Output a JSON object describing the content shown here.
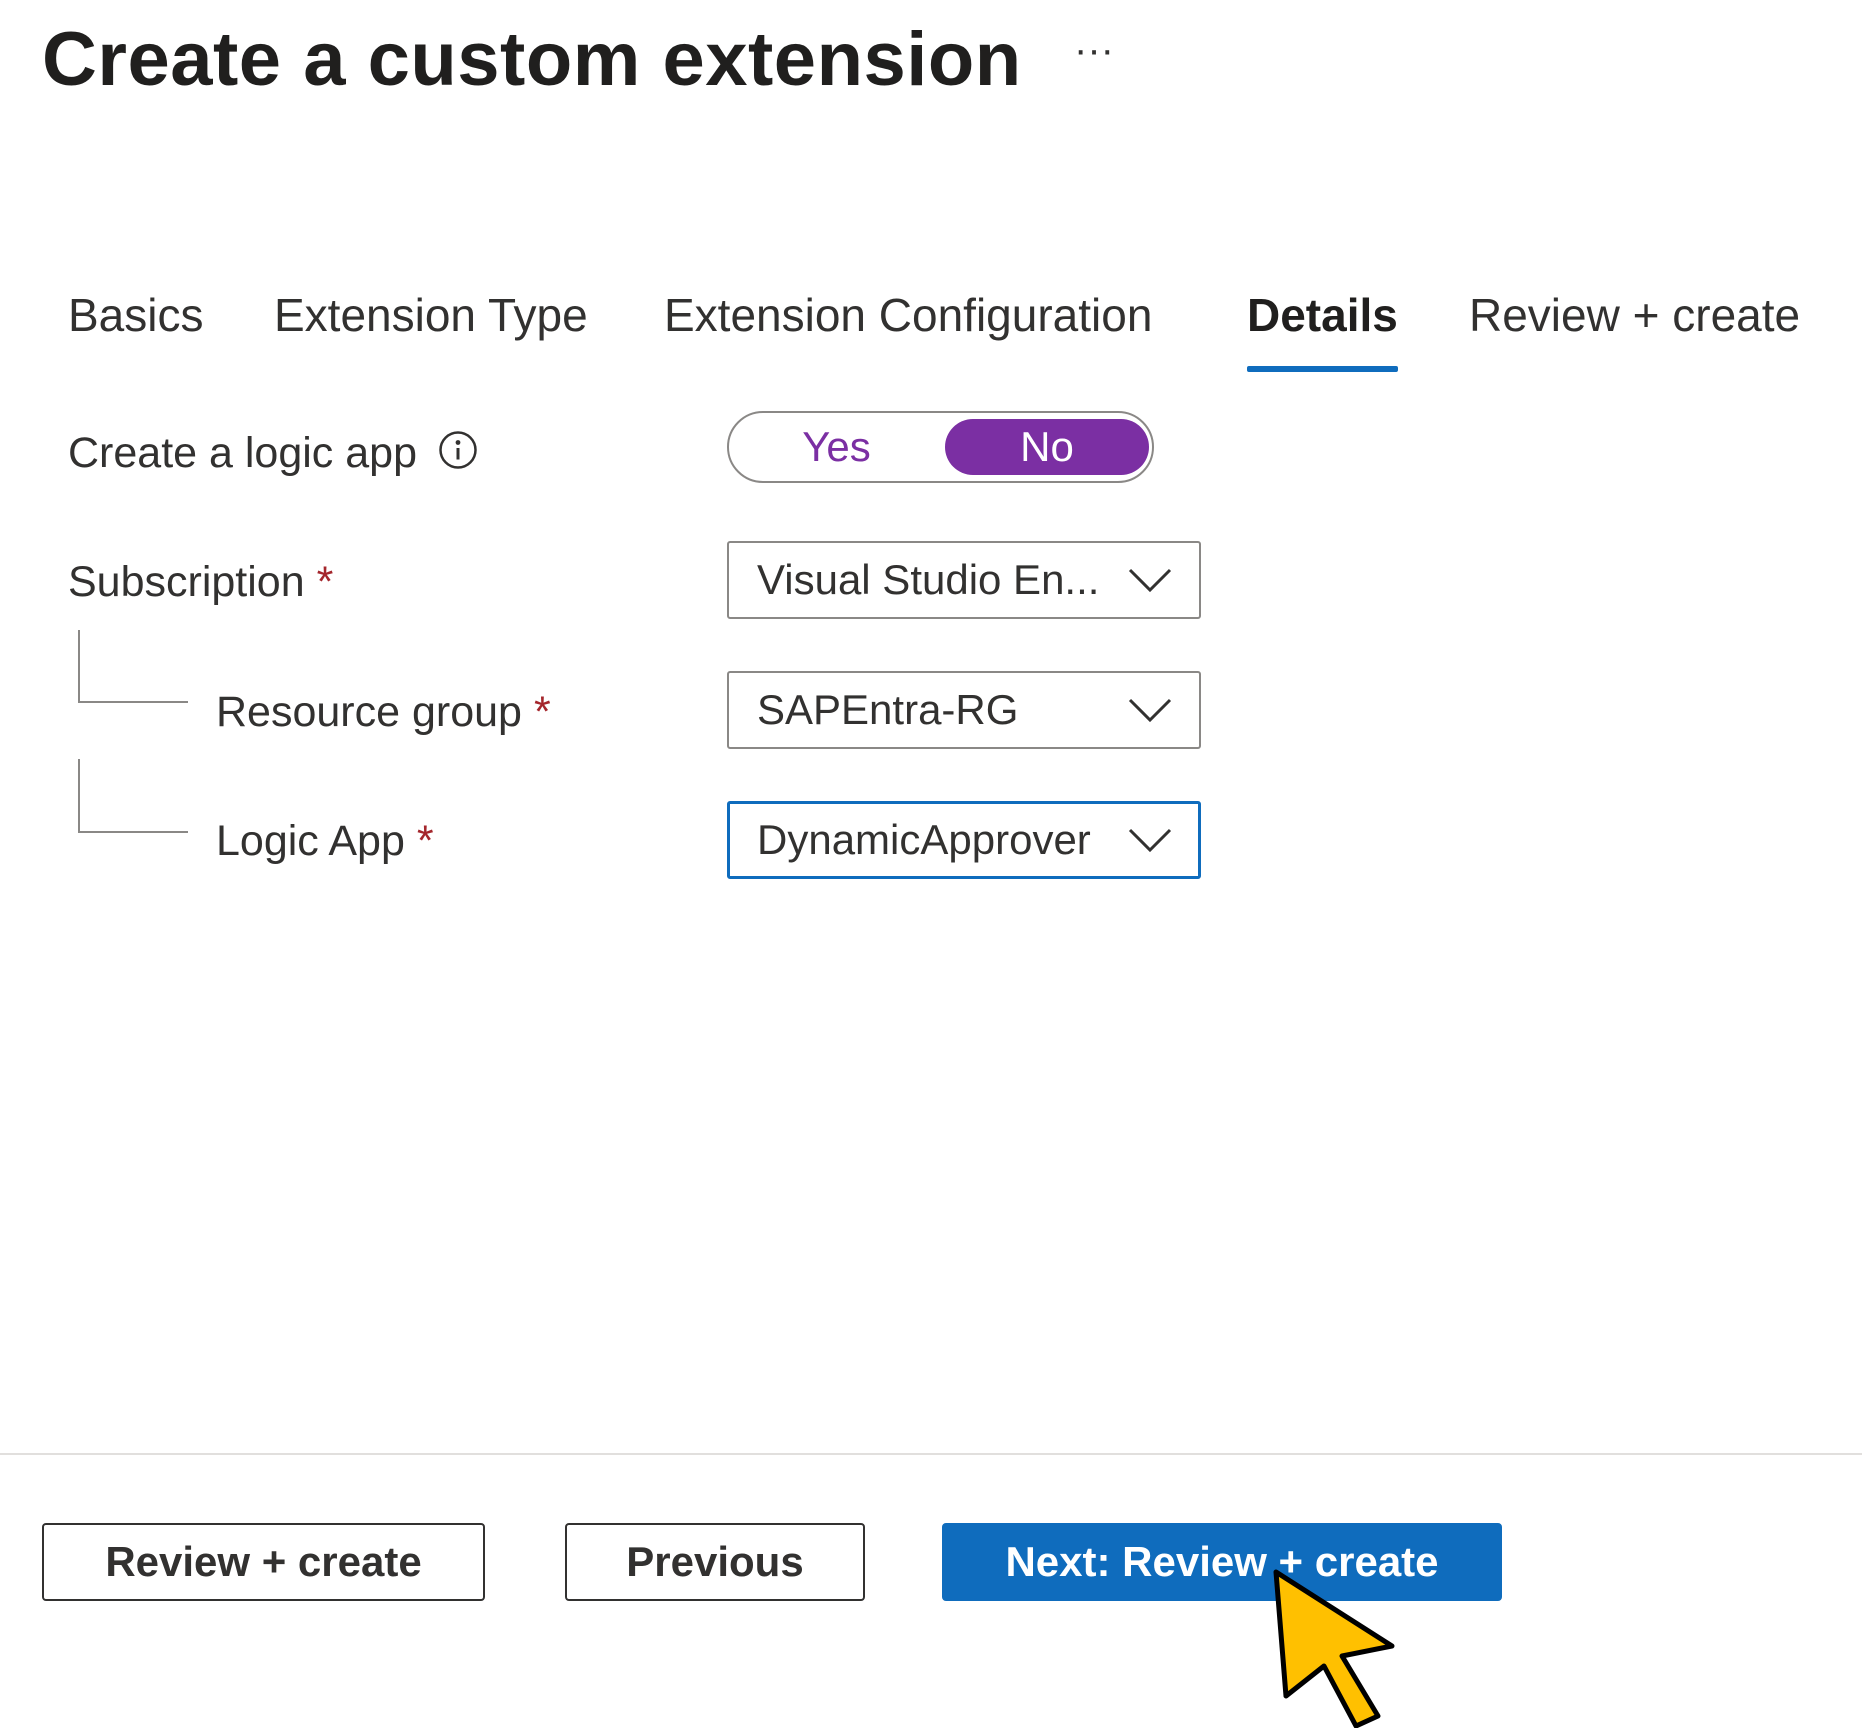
{
  "header": {
    "title": "Create a custom extension",
    "more_label": "···"
  },
  "tabs": [
    {
      "label": "Basics",
      "active": false
    },
    {
      "label": "Extension Type",
      "active": false
    },
    {
      "label": "Extension Configuration",
      "active": false
    },
    {
      "label": "Details",
      "active": true
    },
    {
      "label": "Review + create",
      "active": false
    }
  ],
  "form": {
    "create_logic_app": {
      "label": "Create a logic app",
      "icon": "info-icon",
      "options": [
        "Yes",
        "No"
      ],
      "selected": "No"
    },
    "subscription": {
      "label": "Subscription",
      "required_marker": "*",
      "value": "Visual Studio En..."
    },
    "resource_group": {
      "label": "Resource group",
      "required_marker": "*",
      "value": "SAPEntra-RG"
    },
    "logic_app": {
      "label": "Logic App",
      "required_marker": "*",
      "value": "DynamicApprover"
    }
  },
  "footer": {
    "review_create_label": "Review + create",
    "previous_label": "Previous",
    "next_label": "Next: Review + create"
  },
  "colors": {
    "accent_blue": "#0f6cbd",
    "toggle_purple": "#7b2fa3",
    "required_red": "#a4262c",
    "cursor_yellow": "#ffc000"
  }
}
